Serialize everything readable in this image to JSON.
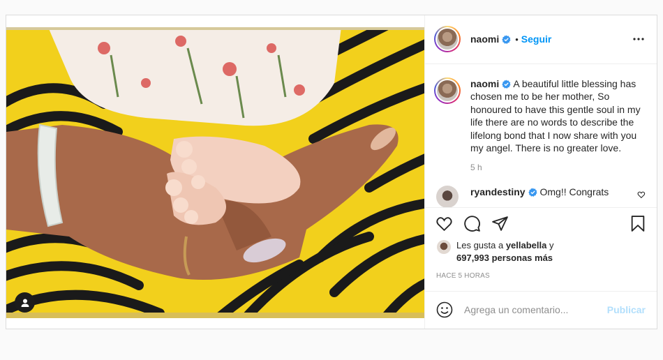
{
  "post": {
    "author": {
      "username": "naomi",
      "verified": true,
      "follow_label": "Seguir",
      "separator": "•"
    },
    "caption": {
      "username": "naomi",
      "text": "A beautiful little blessing has chosen me to be her mother, So honoured to have this gentle soul in my life there are no words to describe the lifelong bond that I now share with you my angel. There is no greater love.",
      "time": "5 h"
    },
    "reply": {
      "username": "ryandestiny",
      "text": "Omg!! Congrats"
    },
    "likes": {
      "prefix": "Les gusta a ",
      "user": "yellabella",
      "suffix": " y",
      "count_text": "697,993 personas más"
    },
    "posted_ago": "HACE 5 HORAS",
    "comment_box": {
      "placeholder": "Agrega un comentario...",
      "publish_label": "Publicar"
    }
  },
  "icons": [
    "more-options-icon",
    "verified-badge-icon",
    "heart-icon",
    "comment-icon",
    "share-icon",
    "save-icon",
    "emoji-icon",
    "user-tag-icon"
  ],
  "colors": {
    "accent": "#0095f6",
    "publish_disabled": "#b2dffc",
    "photo_background": "#f3d41a"
  }
}
